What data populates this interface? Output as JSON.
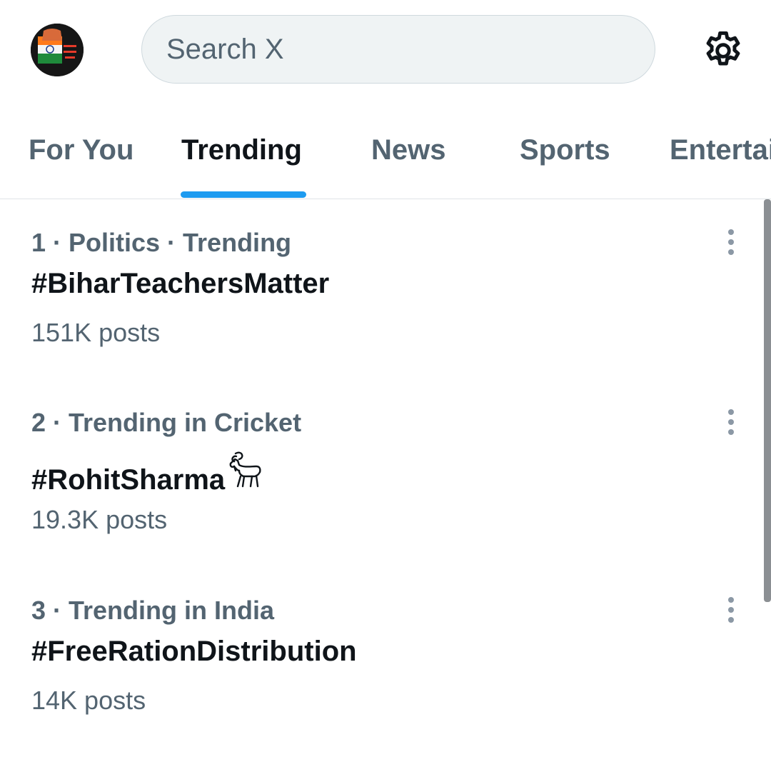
{
  "search": {
    "placeholder": "Search X",
    "value": ""
  },
  "header": {
    "avatar_icon": "profile-avatar",
    "settings_icon": "gear-icon"
  },
  "tabs": [
    {
      "label": "For You",
      "active": false
    },
    {
      "label": "Trending",
      "active": true
    },
    {
      "label": "News",
      "active": false
    },
    {
      "label": "Sports",
      "active": false
    },
    {
      "label": "Entertainment",
      "active": false
    }
  ],
  "trends": [
    {
      "meta": "1 · Politics · Trending",
      "title": "#BiharTeachersMatter",
      "count": "151K posts"
    },
    {
      "meta": "2 · Trending in Cricket",
      "title": "#RohitSharma",
      "title_emoji": "goat-emoji",
      "count": "19.3K posts"
    },
    {
      "meta": "3 · Trending in India",
      "title": "#FreeRationDistribution",
      "count": "14K posts"
    }
  ],
  "colors": {
    "accent": "#1d9bf0",
    "primary_text": "#0f1419",
    "secondary_text": "#536471",
    "search_bg": "#eff3f4"
  }
}
